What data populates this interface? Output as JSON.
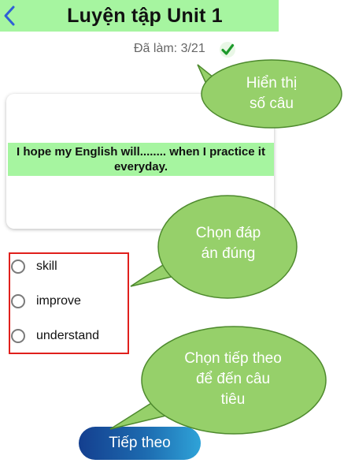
{
  "header": {
    "title": "Luyện tập Unit 1",
    "back_icon": "chevron-left-icon"
  },
  "progress": {
    "label": "Đã làm: 3/21",
    "done": 3,
    "total": 21,
    "icon": "check-circle-icon"
  },
  "question": {
    "text": "I hope my English will........ when I practice it everyday."
  },
  "options": [
    {
      "label": "skill"
    },
    {
      "label": "improve"
    },
    {
      "label": "understand"
    }
  ],
  "callouts": [
    {
      "line1": "Hiển thị",
      "line2": "số câu"
    },
    {
      "line1": "Chọn đáp",
      "line2": "án đúng"
    },
    {
      "line1": "Chọn tiếp theo",
      "line2": "để đến câu",
      "line3": "tiêu"
    }
  ],
  "next_button": {
    "label": "Tiếp theo"
  },
  "colors": {
    "header_bg": "#a6f5a0",
    "bubble_fill": "#96d06a",
    "bubble_stroke": "#4e8a2e",
    "options_border": "#e0201c",
    "check_color": "#1e9a2c",
    "button_gradient_start": "#143f8f",
    "button_gradient_end": "#2fa3d8"
  }
}
